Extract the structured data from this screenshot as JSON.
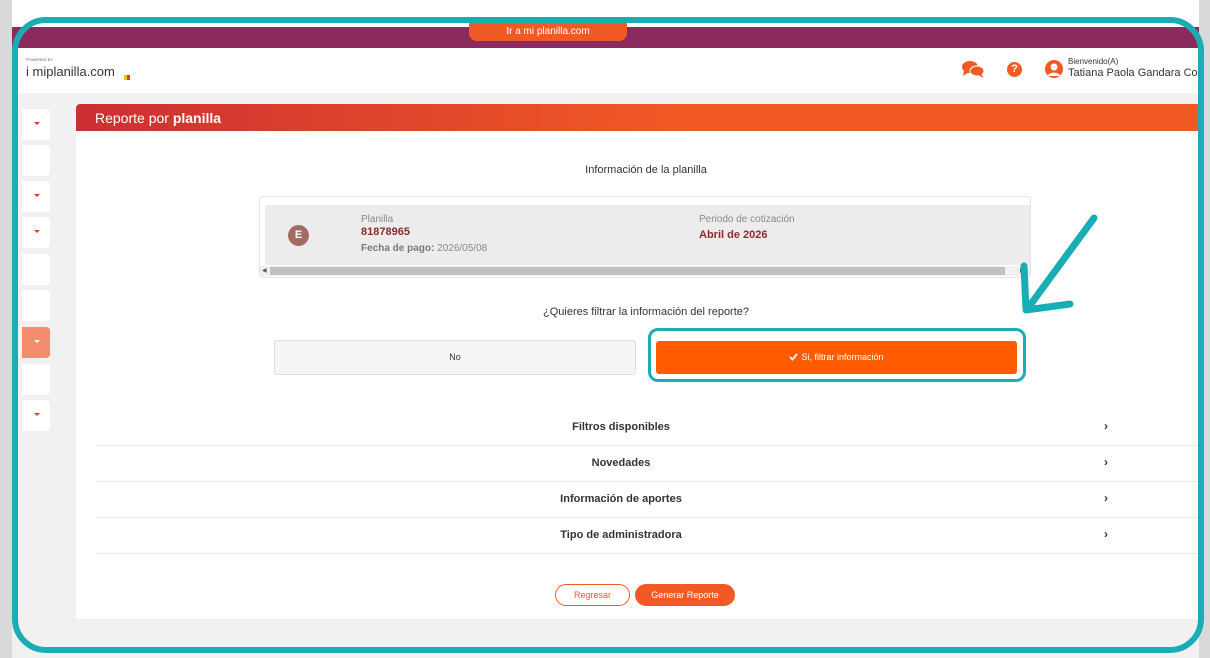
{
  "promo": {
    "button_label": "Ir a mi planilla.com"
  },
  "header": {
    "powered_by": "POWERED BY",
    "logo": "i miplanilla.com",
    "welcome": "Bienvenido(A)",
    "user_name": "Tatiana Paola Gandara Contr",
    "help_glyph": "?",
    "icons": [
      "flag-icon",
      "chat-icon",
      "help-icon",
      "user-icon"
    ]
  },
  "panel": {
    "title_prefix": "Reporte por ",
    "title_bold": "planilla"
  },
  "info": {
    "section_title": "Información de la planilla",
    "badge": "E",
    "planilla_label": "Planilla",
    "planilla_value": "81878965",
    "fecha_label": "Fecha de pago:",
    "fecha_value": "2026/05/08",
    "periodo_label": "Periodo de cotización",
    "periodo_value": "Abril de 2026"
  },
  "filter": {
    "question": "¿Quieres filtrar la información del reporte?",
    "no_label": "No",
    "yes_label": "Si, filtrar información"
  },
  "accordion": [
    {
      "label": "Filtros disponibles"
    },
    {
      "label": "Novedades"
    },
    {
      "label": "Información de aportes"
    },
    {
      "label": "Tipo de administradora"
    }
  ],
  "actions": {
    "back_label": "Regresar",
    "generate_label": "Generar Reporte"
  },
  "colors": {
    "accent": "#f15a24",
    "highlight": "#19aeb5",
    "promo_bar": "#8b2a5c"
  }
}
